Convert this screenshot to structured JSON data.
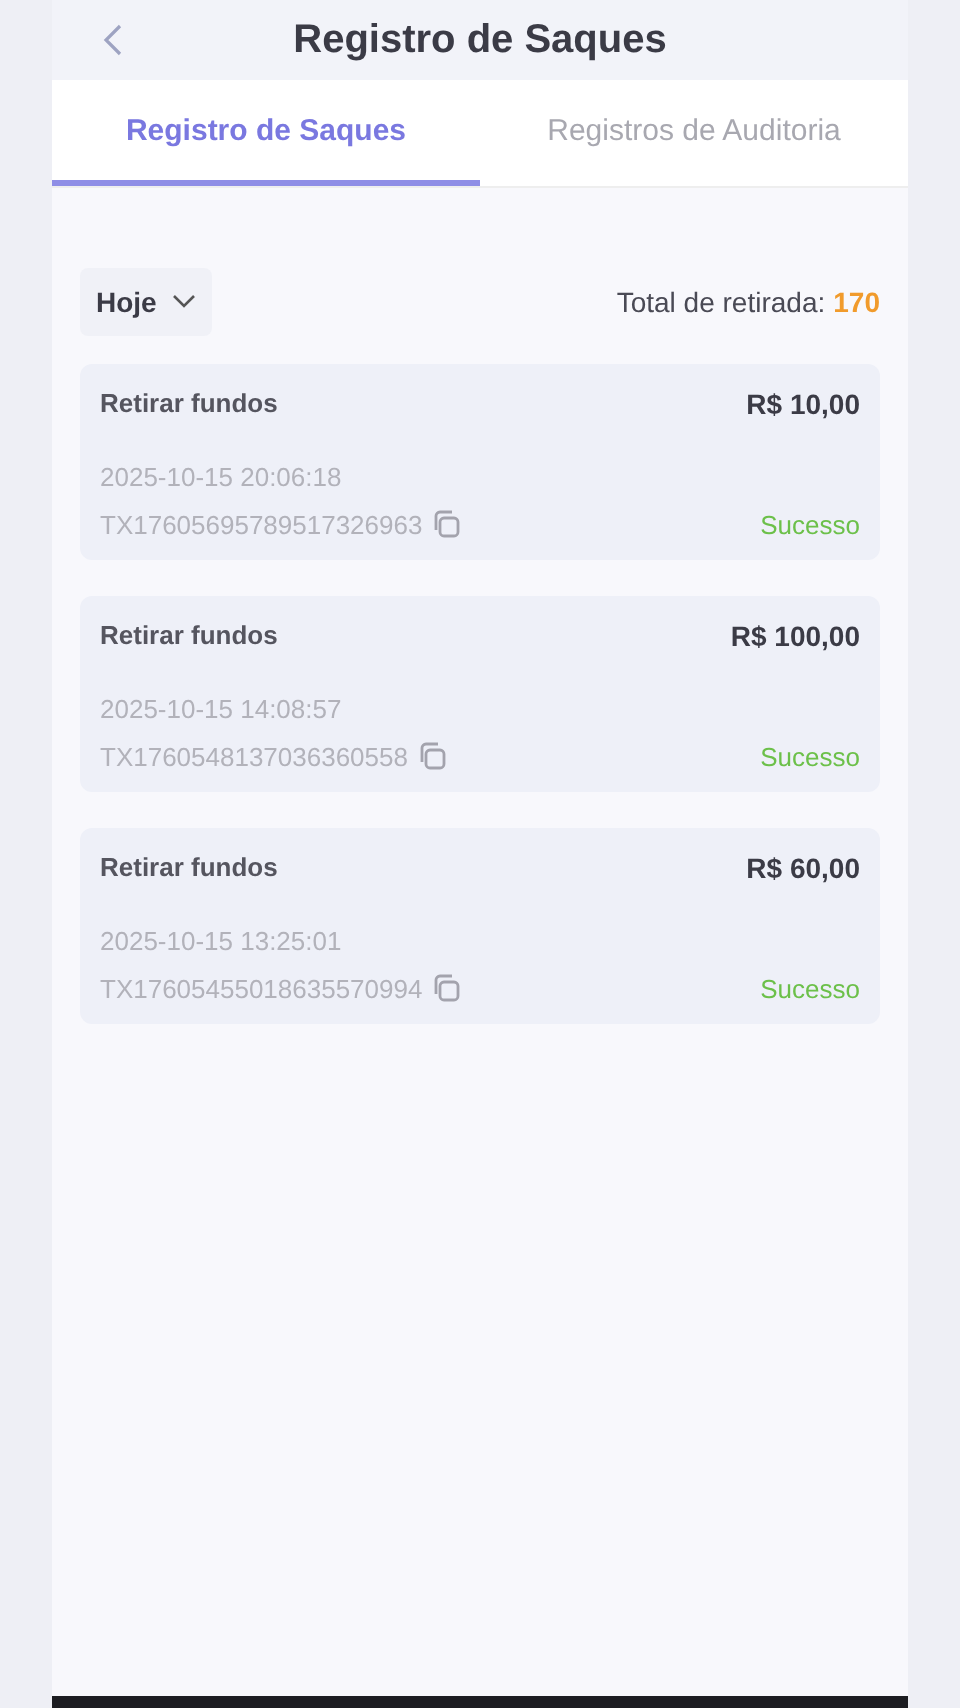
{
  "header": {
    "title": "Registro de Saques"
  },
  "tabs": [
    {
      "label": "Registro de Saques",
      "selected": true
    },
    {
      "label": "Registros de Auditoria",
      "selected": false
    }
  ],
  "filter": {
    "value": "Hoje"
  },
  "total": {
    "label": "Total de retirada:",
    "value": "170"
  },
  "records": [
    {
      "type": "Retirar fundos",
      "amount": "R$ 10,00",
      "datetime": "2025-10-15 20:06:18",
      "txid": "TX17605695789517326963",
      "status": "Sucesso"
    },
    {
      "type": "Retirar fundos",
      "amount": "R$ 100,00",
      "datetime": "2025-10-15 14:08:57",
      "txid": "TX1760548137036360558",
      "status": "Sucesso"
    },
    {
      "type": "Retirar fundos",
      "amount": "R$ 60,00",
      "datetime": "2025-10-15 13:25:01",
      "txid": "TX17605455018635570994",
      "status": "Sucesso"
    }
  ]
}
